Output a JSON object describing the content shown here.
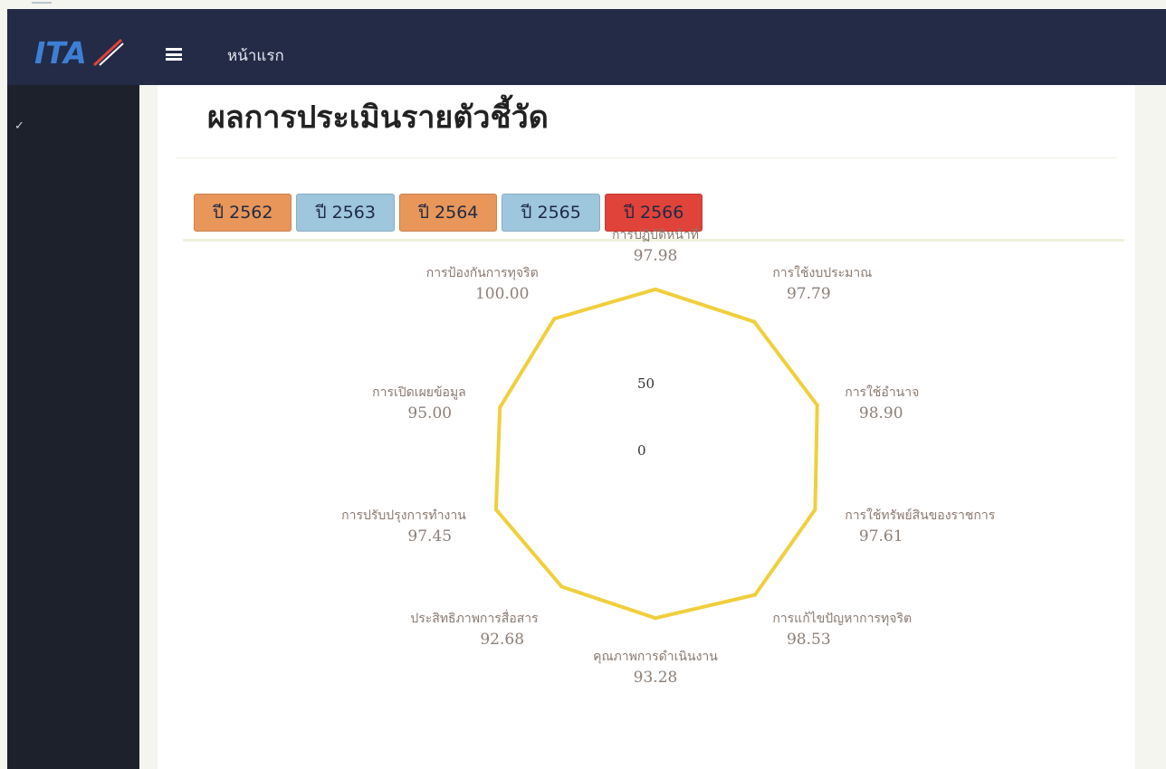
{
  "navbar": {
    "logo_text": "ITA",
    "home_label": "หน้าแรก"
  },
  "page": {
    "title": "ผลการประเมินรายตัวชี้วัด"
  },
  "year_buttons": [
    {
      "label": "ปี 2562",
      "color": "#e8965a"
    },
    {
      "label": "ปี 2563",
      "color": "#9ec6dd"
    },
    {
      "label": "ปี 2564",
      "color": "#e8965a"
    },
    {
      "label": "ปี 2565",
      "color": "#9ec6dd"
    },
    {
      "label": "ปี 2566",
      "color": "#e0433a"
    }
  ],
  "chart_data": {
    "type": "radar",
    "scale_max": 100,
    "ticks": [
      "50",
      "0"
    ],
    "series_color": "#f0cf3c",
    "axes": [
      {
        "label": "การปฏิบัติหน้าที่",
        "value": 97.98,
        "value_text": "97.98"
      },
      {
        "label": "การใช้งบประมาณ",
        "value": 97.79,
        "value_text": "97.79"
      },
      {
        "label": "การใช้อำนาจ",
        "value": 98.9,
        "value_text": "98.90"
      },
      {
        "label": "การใช้ทรัพย์สินของราชการ",
        "value": 97.61,
        "value_text": "97.61"
      },
      {
        "label": "การแก้ไขปัญหาการทุจริต",
        "value": 98.53,
        "value_text": "98.53"
      },
      {
        "label": "คุณภาพการดำเนินงาน",
        "value": 93.28,
        "value_text": "93.28"
      },
      {
        "label": "ประสิทธิภาพการสื่อสาร",
        "value": 92.68,
        "value_text": "92.68"
      },
      {
        "label": "การปรับปรุงการทำงาน",
        "value": 97.45,
        "value_text": "97.45"
      },
      {
        "label": "การเปิดเผยข้อมูล",
        "value": 95.0,
        "value_text": "95.00"
      },
      {
        "label": "การป้องกันการทุจริต",
        "value": 100.0,
        "value_text": "100.00"
      }
    ]
  }
}
